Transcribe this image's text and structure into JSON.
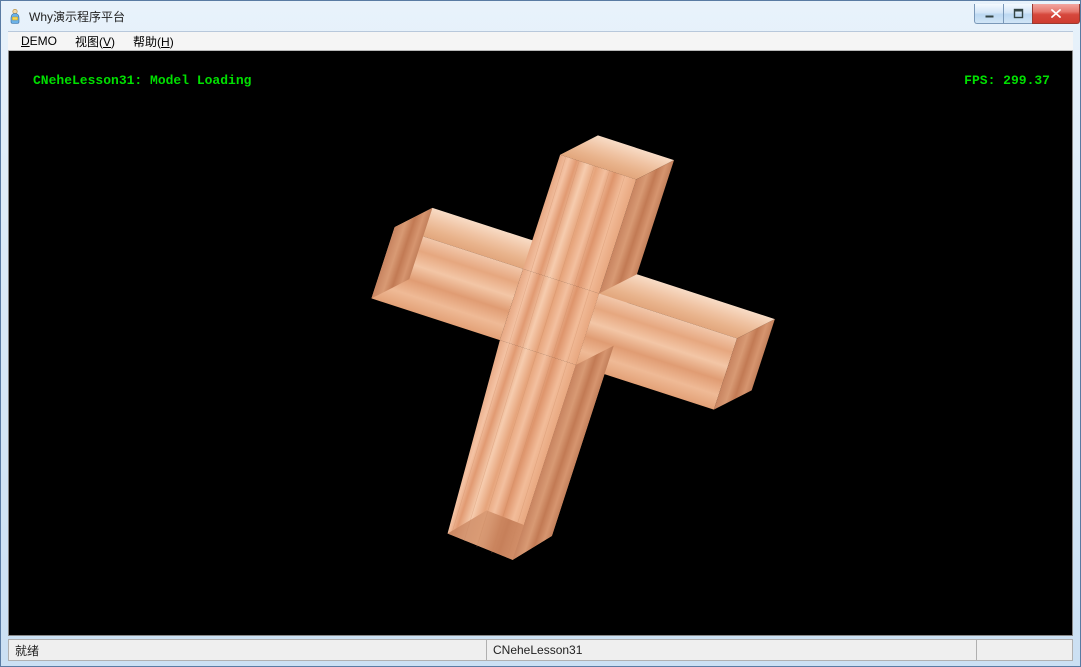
{
  "window": {
    "title": "Why演示程序平台"
  },
  "menu": {
    "items": [
      {
        "label_pre": "",
        "label_u": "D",
        "label_post": "EMO"
      },
      {
        "label_pre": "视图(",
        "label_u": "V",
        "label_post": ")"
      },
      {
        "label_pre": "帮助(",
        "label_u": "H",
        "label_post": ")"
      }
    ]
  },
  "hud": {
    "title": "CNeheLesson31: Model Loading",
    "fps_label": "FPS: 299.37"
  },
  "statusbar": {
    "ready": "就绪",
    "panel1": "CNeheLesson31",
    "panel2": ""
  },
  "icons": {
    "minimize": "minimize-icon",
    "maximize": "maximize-icon",
    "close": "close-icon",
    "app": "app-icon"
  },
  "colors": {
    "accent_text": "#00e000",
    "viewport_bg": "#000000",
    "close_btn": "#d6483d"
  }
}
